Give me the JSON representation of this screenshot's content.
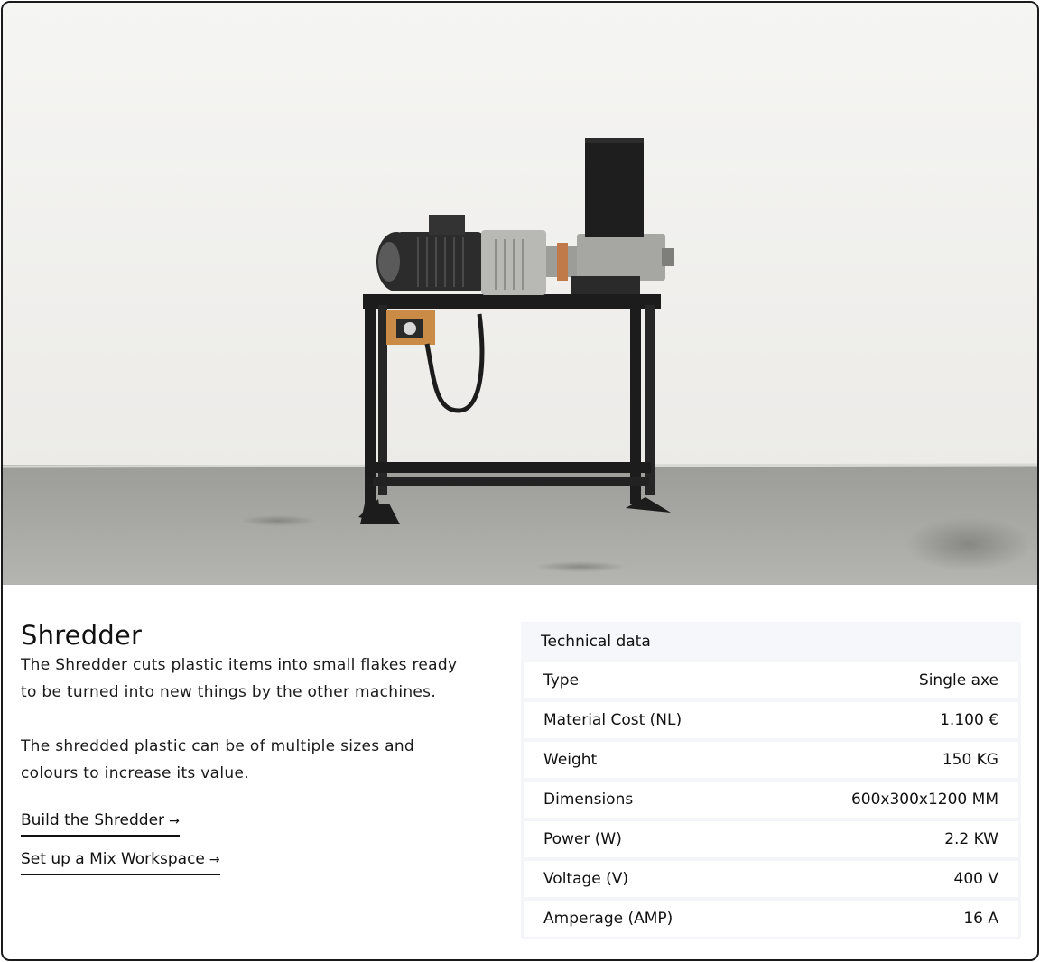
{
  "product": {
    "title": "Shredder",
    "description": [
      "The Shredder cuts plastic items into small flakes ready to be turned into new things by the other machines.",
      "The shredded plastic can be of multiple sizes and colours to increase its value."
    ],
    "links": [
      {
        "label": "Build the Shredder",
        "arrow": "→"
      },
      {
        "label": "Set up a Mix Workspace",
        "arrow": "→"
      }
    ]
  },
  "technical_data": {
    "heading": "Technical data",
    "rows": [
      {
        "label": "Type",
        "value": "Single axe"
      },
      {
        "label": "Material Cost (NL)",
        "value": "1.100 €"
      },
      {
        "label": "Weight",
        "value": "150 KG"
      },
      {
        "label": "Dimensions",
        "value": "600x300x1200 MM"
      },
      {
        "label": "Power (W)",
        "value": "2.2 KW"
      },
      {
        "label": "Voltage (V)",
        "value": "400 V"
      },
      {
        "label": "Amperage (AMP)",
        "value": "16 A"
      }
    ]
  },
  "colors": {
    "border": "#1a1a1a",
    "wall": "#f3f3f1",
    "floor": "#a9a9a6",
    "machine": "#1c1c1c",
    "control_box": "#c98b45",
    "table_header_bg": "#f6f7fb"
  }
}
